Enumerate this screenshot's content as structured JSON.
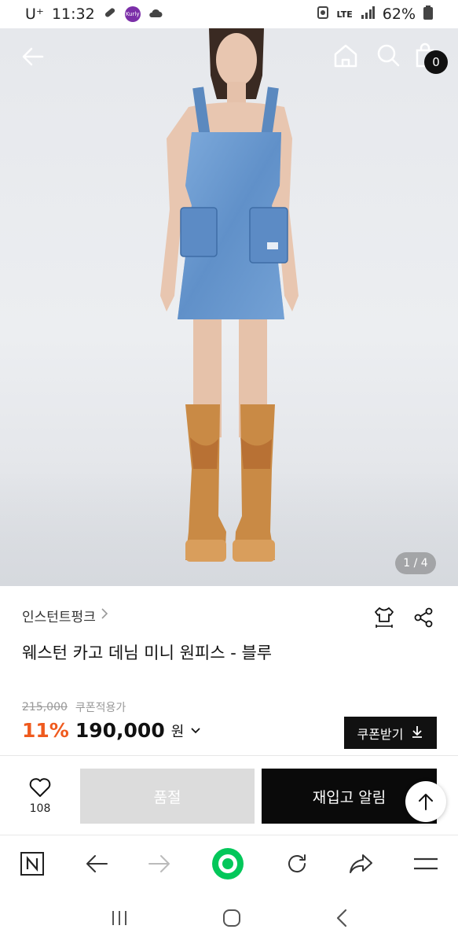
{
  "status_bar": {
    "carrier": "U⁺",
    "time": "11:32",
    "kurly_badge": "Kurly",
    "network": "LTE",
    "battery": "62%"
  },
  "hero": {
    "cart_count": "0",
    "page_indicator": "1 / 4"
  },
  "product": {
    "brand": "인스턴트펑크",
    "title": "웨스턴 카고 데님 미니 원피스 - 블루",
    "original_price": "215,000",
    "coupon_label": "쿠폰적용가",
    "discount": "11%",
    "price": "190,000",
    "currency": "원",
    "coupon_button": "쿠폰받기"
  },
  "actions": {
    "like_count": "108",
    "soldout_label": "품절",
    "restock_label": "재입고 알림"
  },
  "colors": {
    "discount": "#ef5a1e",
    "primary_button": "#0a0a0a",
    "disabled_button": "#dcdcdc",
    "naver_green": "#03c75a"
  }
}
